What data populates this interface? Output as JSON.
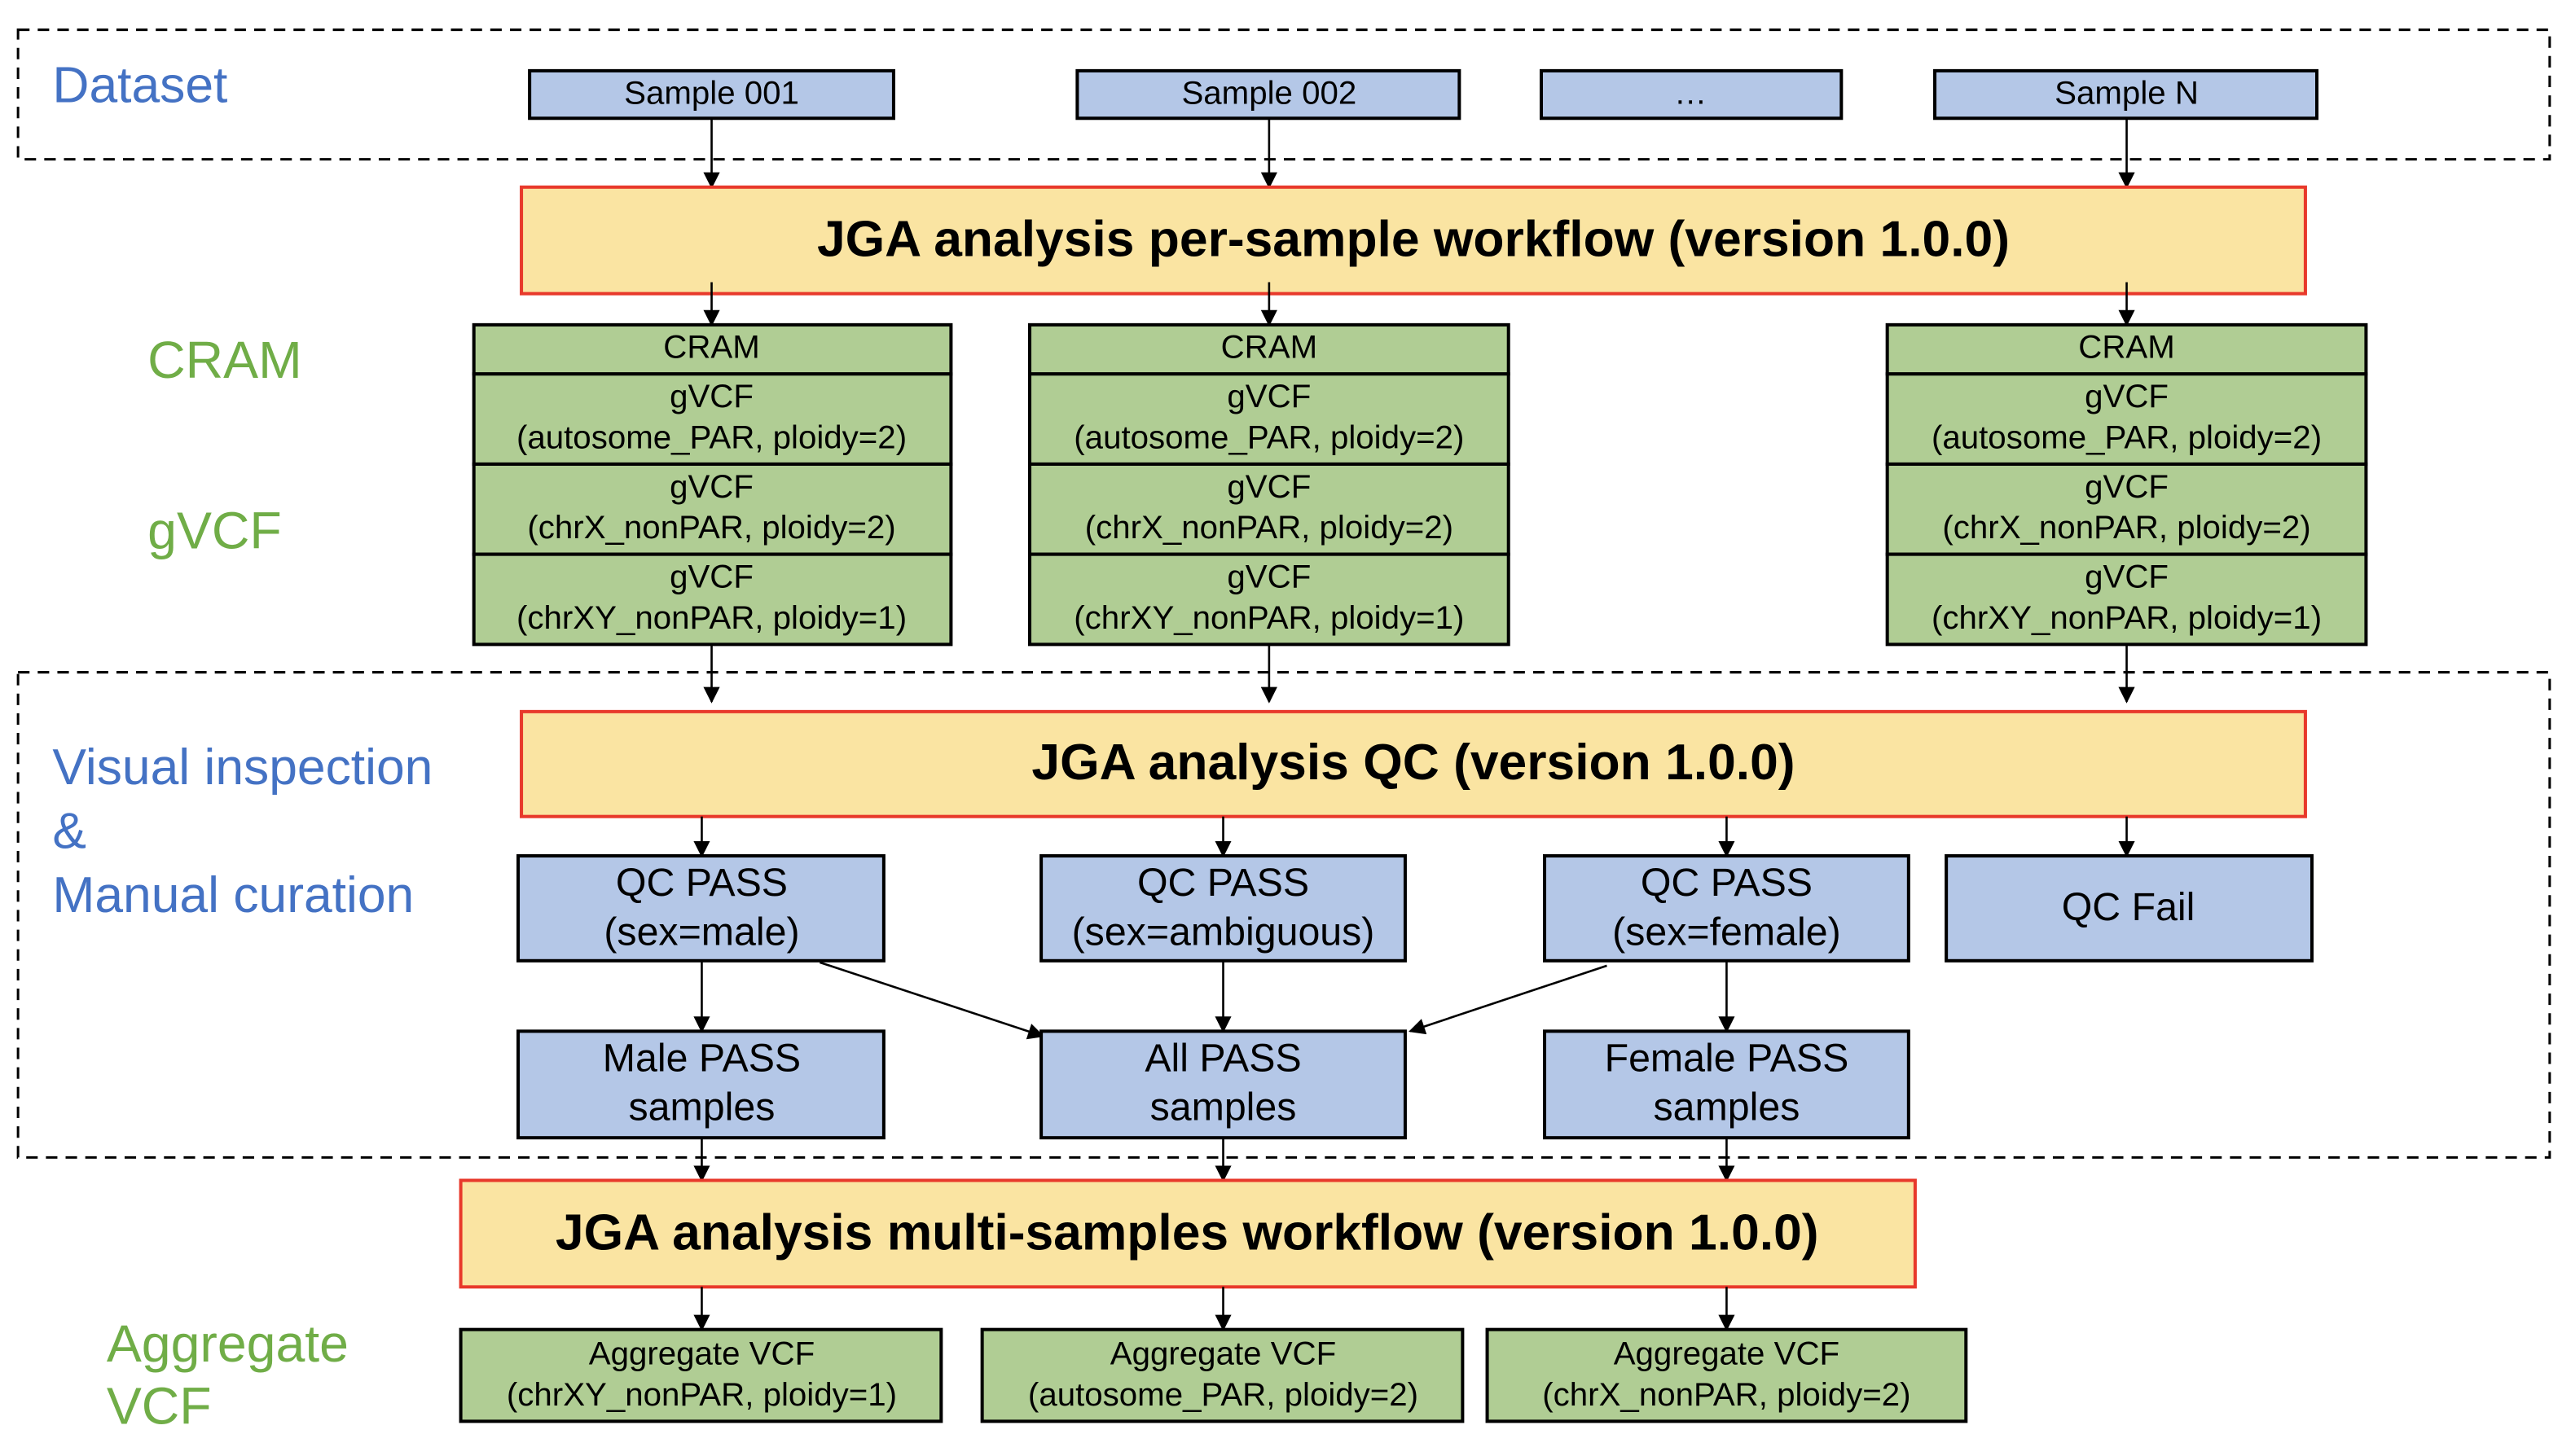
{
  "labels": {
    "dataset": "Dataset",
    "cram": "CRAM",
    "gvcf": "gVCF",
    "visual_inspection": "Visual inspection",
    "ampersand": "&",
    "manual_curation": "Manual curation",
    "aggregate": "Aggregate",
    "vcf": "VCF"
  },
  "samples": [
    "Sample 001",
    "Sample 002",
    "…",
    "Sample N"
  ],
  "workflows": {
    "per_sample": "JGA analysis per-sample workflow (version 1.0.0)",
    "qc": "JGA analysis QC (version 1.0.0)",
    "multi_samples": "JGA analysis multi-samples workflow (version 1.0.0)"
  },
  "outputs": {
    "cram": "CRAM",
    "gvcf_title": "gVCF",
    "gvcf_autosome": "(autosome_PAR, ploidy=2)",
    "gvcf_chrx": "(chrX_nonPAR, ploidy=2)",
    "gvcf_chrxy": "(chrXY_nonPAR, ploidy=1)"
  },
  "qc_results": [
    {
      "line1": "QC PASS",
      "line2": "(sex=male)"
    },
    {
      "line1": "QC PASS",
      "line2": "(sex=ambiguous)"
    },
    {
      "line1": "QC PASS",
      "line2": "(sex=female)"
    },
    {
      "line1": "QC Fail"
    }
  ],
  "groups": [
    {
      "line1": "Male PASS",
      "line2": "samples"
    },
    {
      "line1": "All PASS",
      "line2": "samples"
    },
    {
      "line1": "Female PASS",
      "line2": "samples"
    }
  ],
  "aggregates": [
    {
      "line1": "Aggregate VCF",
      "line2": "(chrXY_nonPAR, ploidy=1)"
    },
    {
      "line1": "Aggregate VCF",
      "line2": "(autosome_PAR, ploidy=2)"
    },
    {
      "line1": "Aggregate VCF",
      "line2": "(chrX_nonPAR, ploidy=2)"
    }
  ],
  "colors": {
    "sample_box": "#B4C7E7",
    "output_box": "#B0CD94",
    "workflow_box": "#FAE4A2",
    "workflow_border": "#E8392B",
    "label_blue": "#4472C4",
    "label_green": "#70AD47"
  }
}
